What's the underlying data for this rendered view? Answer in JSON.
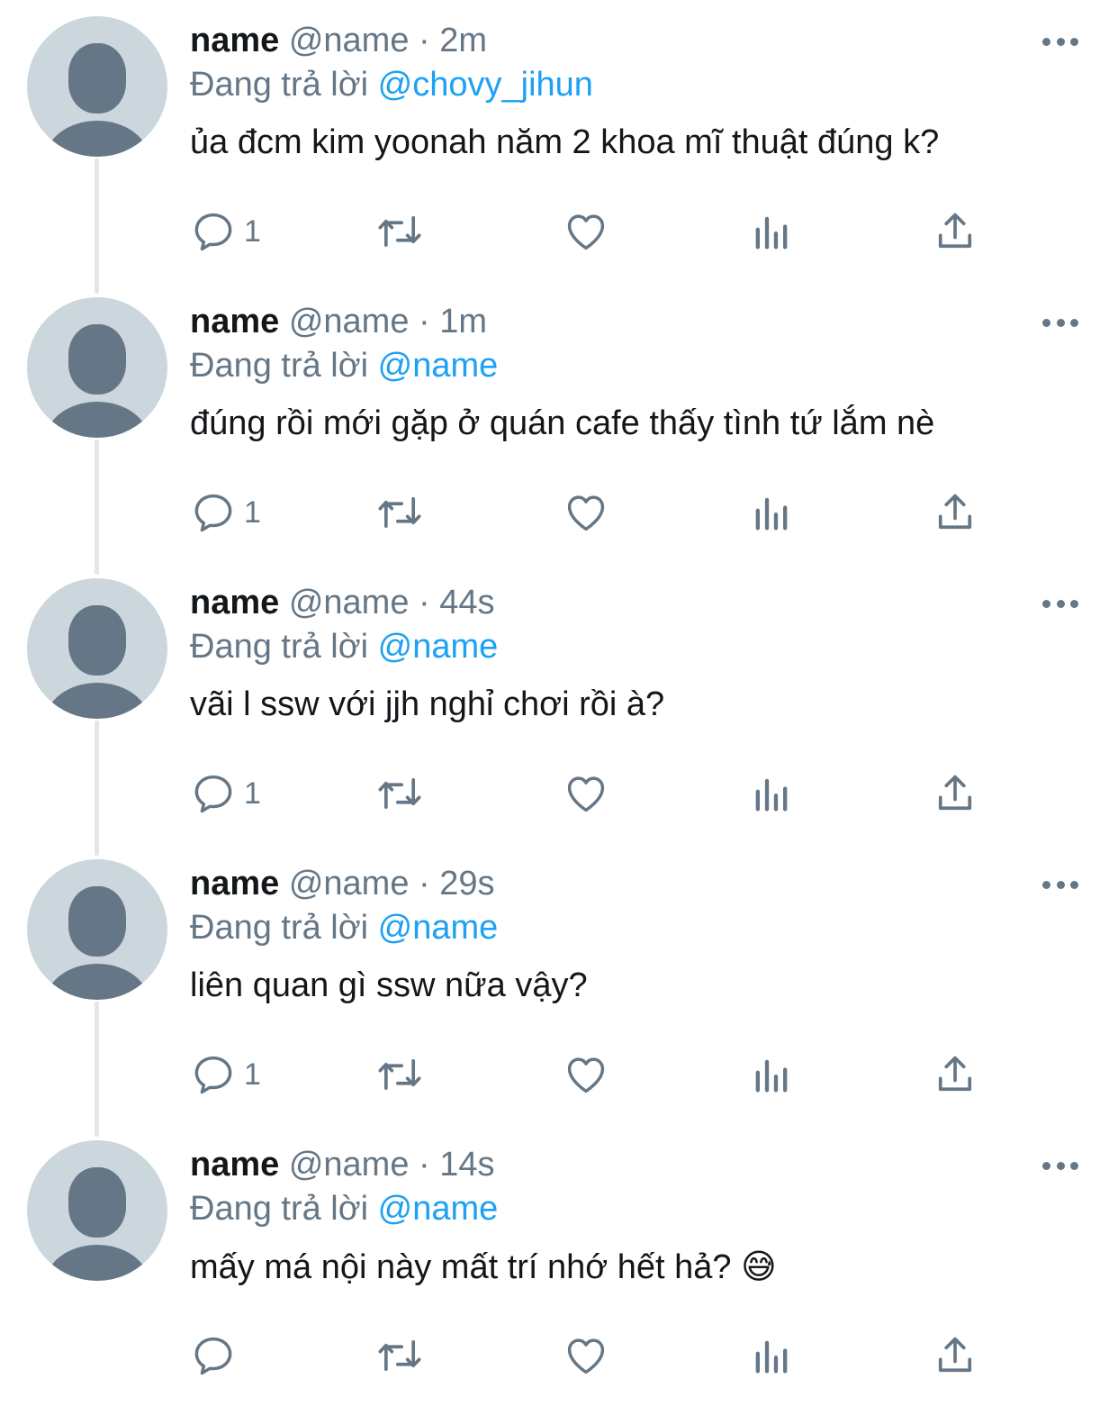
{
  "colors": {
    "accent": "#1da1f2",
    "secondary_text": "#657786",
    "primary_text": "#14171a",
    "avatar_bg": "#ccd6dd",
    "avatar_fg": "#657786",
    "thread_line": "#e1e8ed"
  },
  "icons": {
    "reply": "reply-icon",
    "retweet": "retweet-icon",
    "like": "heart-icon",
    "analytics": "analytics-icon",
    "share": "share-icon",
    "more": "more-options-icon"
  },
  "tweets": [
    {
      "display_name": "name",
      "handle": "@name",
      "separator": "·",
      "time": "2m",
      "reply_prefix": "Đang trả lời",
      "reply_to": "@chovy_jihun",
      "text": "ủa đcm kim yoonah năm 2 khoa mĩ thuật đúng k?",
      "reply_count": "1"
    },
    {
      "display_name": "name",
      "handle": "@name",
      "separator": "·",
      "time": "1m",
      "reply_prefix": "Đang trả lời",
      "reply_to": "@name",
      "text": "đúng rồi mới gặp ở quán cafe thấy tình tứ lắm nè",
      "reply_count": "1"
    },
    {
      "display_name": "name",
      "handle": "@name",
      "separator": "·",
      "time": "44s",
      "reply_prefix": "Đang trả lời",
      "reply_to": "@name",
      "text": "vãi l ssw với jjh nghỉ chơi rồi à?",
      "reply_count": "1"
    },
    {
      "display_name": "name",
      "handle": "@name",
      "separator": "·",
      "time": "29s",
      "reply_prefix": "Đang trả lời",
      "reply_to": "@name",
      "text": "liên quan gì ssw nữa vậy?",
      "reply_count": "1"
    },
    {
      "display_name": "name",
      "handle": "@name",
      "separator": "·",
      "time": "14s",
      "reply_prefix": "Đang trả lời",
      "reply_to": "@name",
      "text": "mấy má nội này mất trí nhớ hết hả?",
      "emoji": "😅",
      "reply_count": ""
    }
  ]
}
